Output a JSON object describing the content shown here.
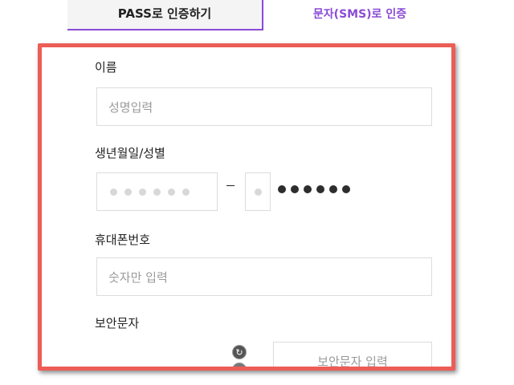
{
  "tabs": {
    "pass_label": "PASS로 인증하기",
    "sms_label": "문자(SMS)로 인증"
  },
  "form": {
    "name": {
      "label": "이름",
      "placeholder": "성명입력"
    },
    "birth": {
      "label": "생년월일/성별",
      "birth_dots": 6,
      "gender_dots": 1,
      "masked_dots": 6
    },
    "phone": {
      "label": "휴대폰번호",
      "placeholder": "숫자만 입력"
    },
    "captcha": {
      "label": "보안문자",
      "placeholder": "보안문자 입력"
    }
  },
  "colors": {
    "accent_purple": "#8a4bd6",
    "highlight_border": "#ec5d56"
  }
}
